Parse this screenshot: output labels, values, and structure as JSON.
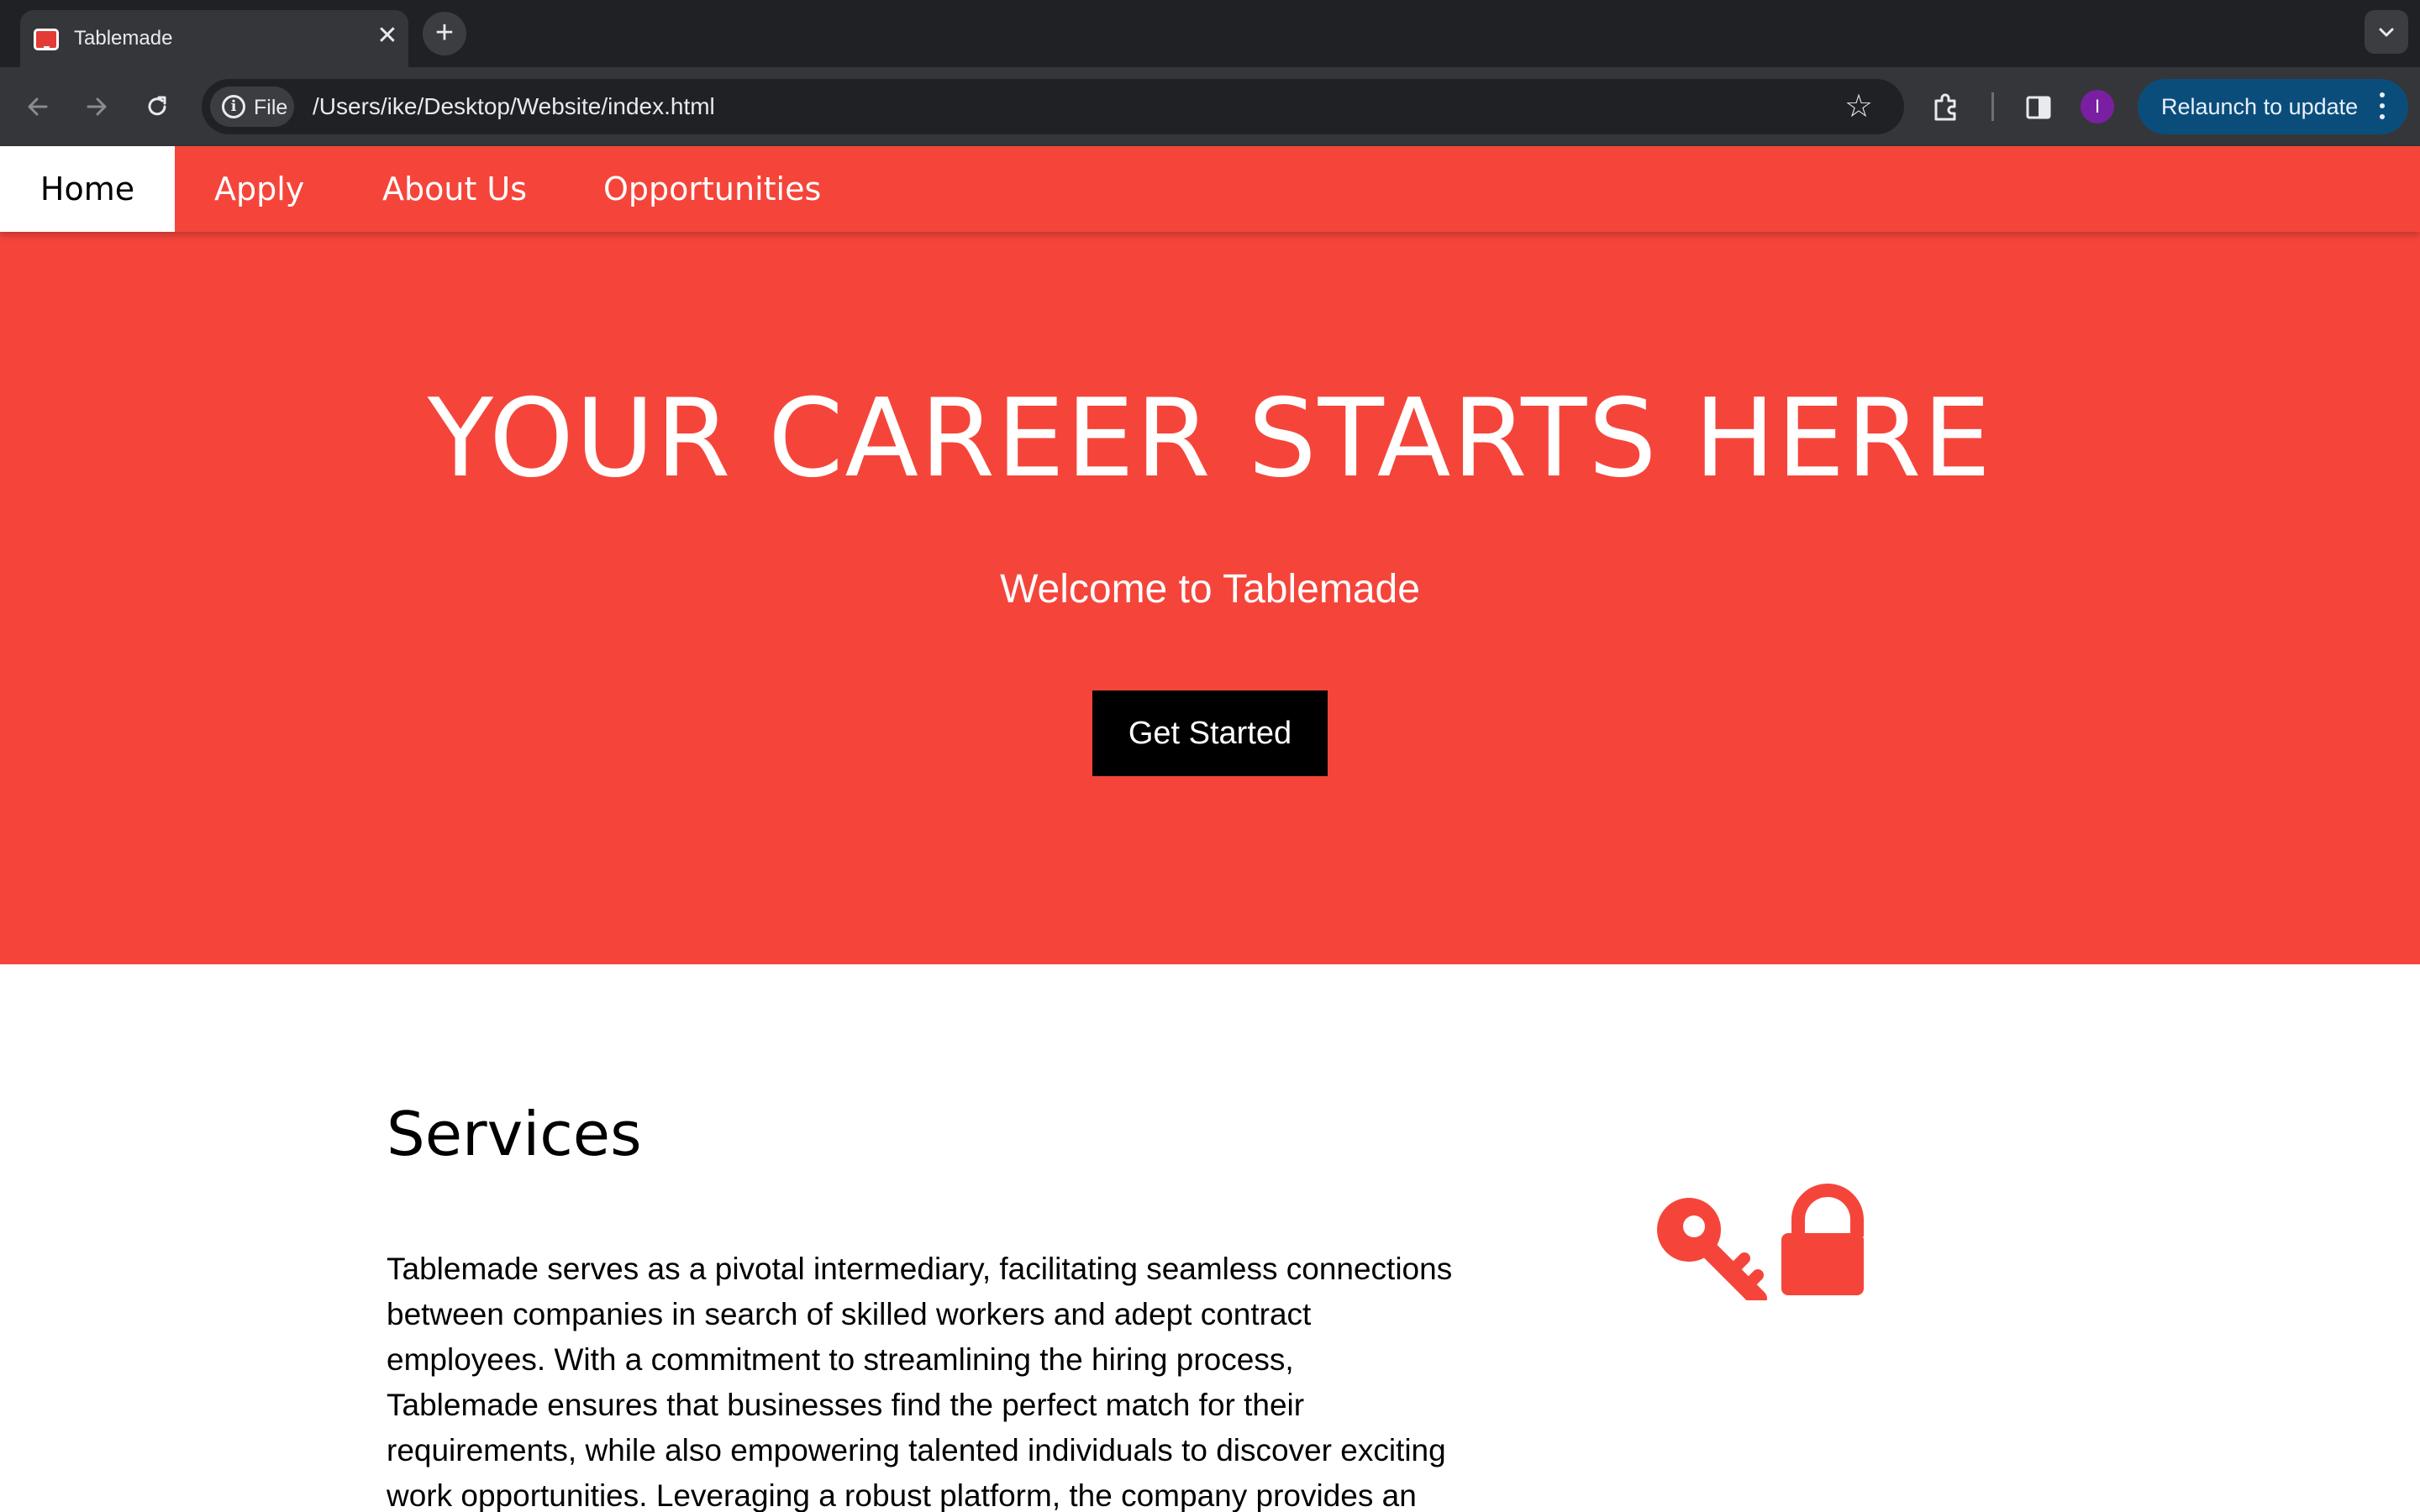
{
  "browser": {
    "tab_title": "Tablemade",
    "tab_close_glyph": "✕",
    "new_tab_glyph": "+",
    "site_info_label": "File",
    "url": "/Users/ike/Desktop/Website/index.html",
    "bookmark_glyph": "☆",
    "profile_initial": "I",
    "relaunch_label": "Relaunch to update",
    "profile_color": "#7b1fa2",
    "relaunch_color": "#0b4d7a"
  },
  "site": {
    "brand_color": "#f5453b",
    "nav": {
      "items": [
        {
          "label": "Home",
          "active": true
        },
        {
          "label": "Apply",
          "active": false
        },
        {
          "label": "About Us",
          "active": false
        },
        {
          "label": "Opportunities",
          "active": false
        }
      ]
    },
    "hero": {
      "title": "YOUR CAREER STARTS HERE",
      "subtitle": "Welcome to Tablemade",
      "cta_label": "Get Started"
    },
    "services": {
      "heading": "Services",
      "body": "Tablemade serves as a pivotal intermediary, facilitating seamless connections between companies in search of skilled workers and adept contract employees. With a commitment to streamlining the hiring process, Tablemade ensures that businesses find the perfect match for their requirements, while also empowering talented individuals to discover exciting work opportunities. Leveraging a robust platform, the company provides an efficient and transparent marketplace for",
      "icons": [
        "key-icon",
        "lock-icon"
      ]
    }
  }
}
